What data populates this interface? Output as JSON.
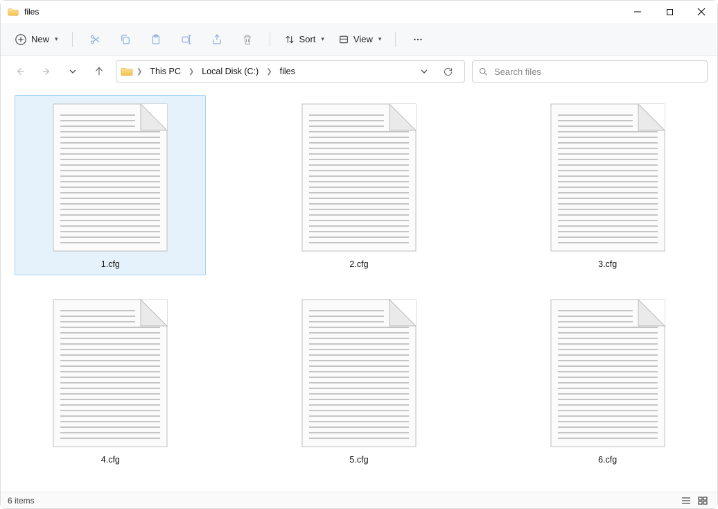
{
  "window": {
    "title": "files"
  },
  "toolbar": {
    "new_label": "New",
    "sort_label": "Sort",
    "view_label": "View"
  },
  "breadcrumbs": {
    "item0": "This PC",
    "item1": "Local Disk (C:)",
    "item2": "files"
  },
  "search": {
    "placeholder": "Search files"
  },
  "files": {
    "f0": {
      "name": "1.cfg"
    },
    "f1": {
      "name": "2.cfg"
    },
    "f2": {
      "name": "3.cfg"
    },
    "f3": {
      "name": "4.cfg"
    },
    "f4": {
      "name": "5.cfg"
    },
    "f5": {
      "name": "6.cfg"
    }
  },
  "status": {
    "items_text": "6 items"
  }
}
